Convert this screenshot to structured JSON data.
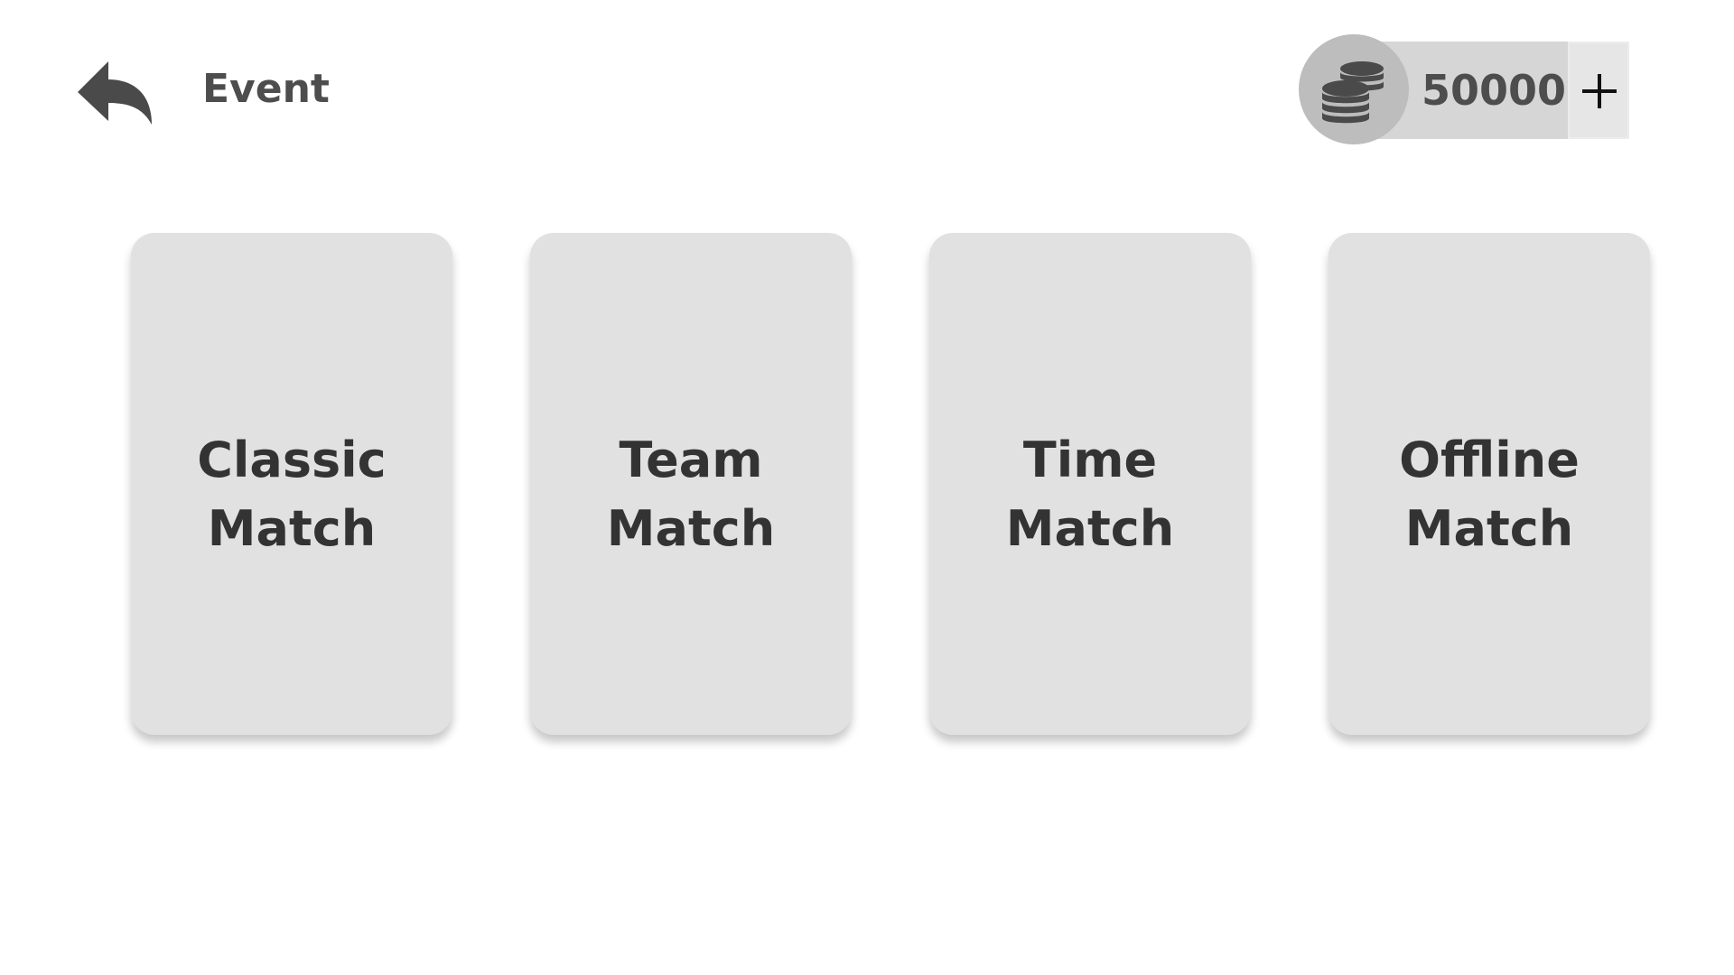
{
  "header": {
    "back_icon": "back-arrow-icon",
    "title": "Event"
  },
  "wallet": {
    "coin_icon": "coins-stack-icon",
    "amount": "50000",
    "add_icon": "plus-icon"
  },
  "modes": [
    {
      "line1": "Classic",
      "line2": "Match"
    },
    {
      "line1": "Team",
      "line2": "Match"
    },
    {
      "line1": "Time",
      "line2": "Match"
    },
    {
      "line1": "Offline",
      "line2": "Match"
    }
  ],
  "colors": {
    "card_background": "#e1e1e1",
    "text": "#333333",
    "coin_circle": "#bdbdbd",
    "coin_bar": "#d6d6d6"
  }
}
